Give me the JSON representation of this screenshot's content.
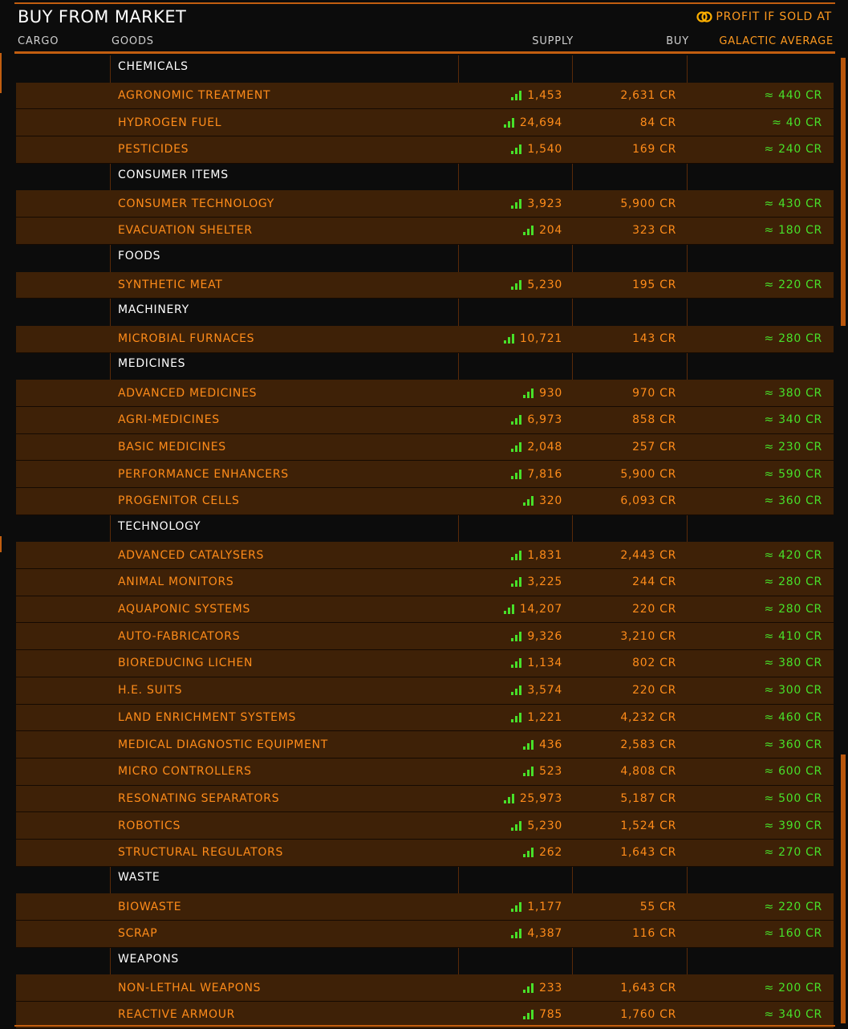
{
  "header": {
    "title": "BUY FROM MARKET",
    "profit_label": "PROFIT IF SOLD AT",
    "columns": {
      "cargo": "CARGO",
      "goods": "GOODS",
      "supply": "SUPPLY",
      "buy": "BUY",
      "galactic_average": "GALACTIC AVERAGE"
    }
  },
  "colors": {
    "accent": "#c25e10",
    "item_text": "#ff8c1a",
    "row_bg": "#3e2107",
    "supply_bars": "#48e02a",
    "category_text": "#ffffff"
  },
  "rows": [
    {
      "type": "category",
      "name": "CHEMICALS"
    },
    {
      "type": "item",
      "name": "AGRONOMIC TREATMENT",
      "supply": "1,453",
      "buy": "2,631 CR",
      "avg": "≈ 440 CR"
    },
    {
      "type": "item",
      "name": "HYDROGEN FUEL",
      "supply": "24,694",
      "buy": "84 CR",
      "avg": "≈ 40 CR"
    },
    {
      "type": "item",
      "name": "PESTICIDES",
      "supply": "1,540",
      "buy": "169 CR",
      "avg": "≈ 240 CR"
    },
    {
      "type": "category",
      "name": "CONSUMER ITEMS"
    },
    {
      "type": "item",
      "name": "CONSUMER TECHNOLOGY",
      "supply": "3,923",
      "buy": "5,900 CR",
      "avg": "≈ 430 CR"
    },
    {
      "type": "item",
      "name": "EVACUATION SHELTER",
      "supply": "204",
      "buy": "323 CR",
      "avg": "≈ 180 CR"
    },
    {
      "type": "category",
      "name": "FOODS"
    },
    {
      "type": "item",
      "name": "SYNTHETIC MEAT",
      "supply": "5,230",
      "buy": "195 CR",
      "avg": "≈ 220 CR"
    },
    {
      "type": "category",
      "name": "MACHINERY"
    },
    {
      "type": "item",
      "name": "MICROBIAL FURNACES",
      "supply": "10,721",
      "buy": "143 CR",
      "avg": "≈ 280 CR"
    },
    {
      "type": "category",
      "name": "MEDICINES"
    },
    {
      "type": "item",
      "name": "ADVANCED MEDICINES",
      "supply": "930",
      "buy": "970 CR",
      "avg": "≈ 380 CR"
    },
    {
      "type": "item",
      "name": "AGRI-MEDICINES",
      "supply": "6,973",
      "buy": "858 CR",
      "avg": "≈ 340 CR"
    },
    {
      "type": "item",
      "name": "BASIC MEDICINES",
      "supply": "2,048",
      "buy": "257 CR",
      "avg": "≈ 230 CR"
    },
    {
      "type": "item",
      "name": "PERFORMANCE ENHANCERS",
      "supply": "7,816",
      "buy": "5,900 CR",
      "avg": "≈ 590 CR"
    },
    {
      "type": "item",
      "name": "PROGENITOR CELLS",
      "supply": "320",
      "buy": "6,093 CR",
      "avg": "≈ 360 CR"
    },
    {
      "type": "category",
      "name": "TECHNOLOGY"
    },
    {
      "type": "item",
      "name": "ADVANCED CATALYSERS",
      "supply": "1,831",
      "buy": "2,443 CR",
      "avg": "≈ 420 CR"
    },
    {
      "type": "item",
      "name": "ANIMAL MONITORS",
      "supply": "3,225",
      "buy": "244 CR",
      "avg": "≈ 280 CR"
    },
    {
      "type": "item",
      "name": "AQUAPONIC SYSTEMS",
      "supply": "14,207",
      "buy": "220 CR",
      "avg": "≈ 280 CR"
    },
    {
      "type": "item",
      "name": "AUTO-FABRICATORS",
      "supply": "9,326",
      "buy": "3,210 CR",
      "avg": "≈ 410 CR"
    },
    {
      "type": "item",
      "name": "BIOREDUCING LICHEN",
      "supply": "1,134",
      "buy": "802 CR",
      "avg": "≈ 380 CR"
    },
    {
      "type": "item",
      "name": "H.E. SUITS",
      "supply": "3,574",
      "buy": "220 CR",
      "avg": "≈ 300 CR"
    },
    {
      "type": "item",
      "name": "LAND ENRICHMENT SYSTEMS",
      "supply": "1,221",
      "buy": "4,232 CR",
      "avg": "≈ 460 CR"
    },
    {
      "type": "item",
      "name": "MEDICAL DIAGNOSTIC EQUIPMENT",
      "supply": "436",
      "buy": "2,583 CR",
      "avg": "≈ 360 CR"
    },
    {
      "type": "item",
      "name": "MICRO CONTROLLERS",
      "supply": "523",
      "buy": "4,808 CR",
      "avg": "≈ 600 CR"
    },
    {
      "type": "item",
      "name": "RESONATING SEPARATORS",
      "supply": "25,973",
      "buy": "5,187 CR",
      "avg": "≈ 500 CR"
    },
    {
      "type": "item",
      "name": "ROBOTICS",
      "supply": "5,230",
      "buy": "1,524 CR",
      "avg": "≈ 390 CR"
    },
    {
      "type": "item",
      "name": "STRUCTURAL REGULATORS",
      "supply": "262",
      "buy": "1,643 CR",
      "avg": "≈ 270 CR"
    },
    {
      "type": "category",
      "name": "WASTE"
    },
    {
      "type": "item",
      "name": "BIOWASTE",
      "supply": "1,177",
      "buy": "55 CR",
      "avg": "≈ 220 CR"
    },
    {
      "type": "item",
      "name": "SCRAP",
      "supply": "4,387",
      "buy": "116 CR",
      "avg": "≈ 160 CR"
    },
    {
      "type": "category",
      "name": "WEAPONS"
    },
    {
      "type": "item",
      "name": "NON-LETHAL WEAPONS",
      "supply": "233",
      "buy": "1,643 CR",
      "avg": "≈ 200 CR"
    },
    {
      "type": "item",
      "name": "REACTIVE ARMOUR",
      "supply": "785",
      "buy": "1,760 CR",
      "avg": "≈ 340 CR"
    }
  ]
}
